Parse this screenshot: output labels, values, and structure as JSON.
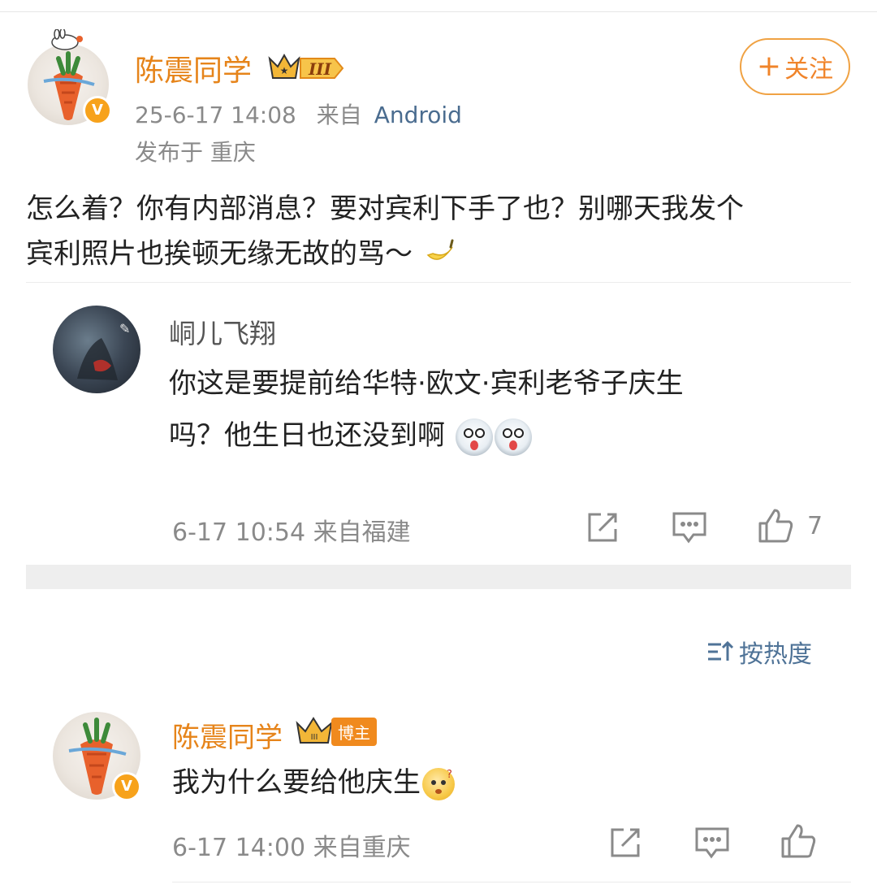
{
  "post": {
    "author": "陈震同学",
    "level_badge": "III",
    "timestamp": "25-6-17 14:08",
    "source_prefix": "来自",
    "source_app": "Android",
    "location": "发布于 重庆",
    "follow_label": "关注",
    "follow_plus": "+",
    "text_line1": "怎么着？你有内部消息？要对宾利下手了也？别哪天我发个",
    "text_line2": "宾利照片也挨顿无缘无故的骂～",
    "text_emoji": "banana"
  },
  "quoted_comment": {
    "author": "峒儿飞翔",
    "text_line1": "你这是要提前给华特·欧文·宾利老爷子庆生",
    "text_line2": "吗？他生日也还没到啊",
    "emojis": [
      "dog-emoji",
      "dog-emoji"
    ],
    "meta": "6-17 10:54 来自福建",
    "like_count": "7"
  },
  "sort": {
    "label": "按热度"
  },
  "reply": {
    "author": "陈震同学",
    "author_tag": "博主",
    "text": "我为什么要给他庆生",
    "emoji": "thinking-emoji",
    "meta": "6-17 14:00 来自重庆"
  },
  "colors": {
    "name_orange": "#e6841a",
    "follow_orange": "#f0a243",
    "link_blue": "#4a6c8f",
    "verified_badge": "#f7a21b"
  }
}
